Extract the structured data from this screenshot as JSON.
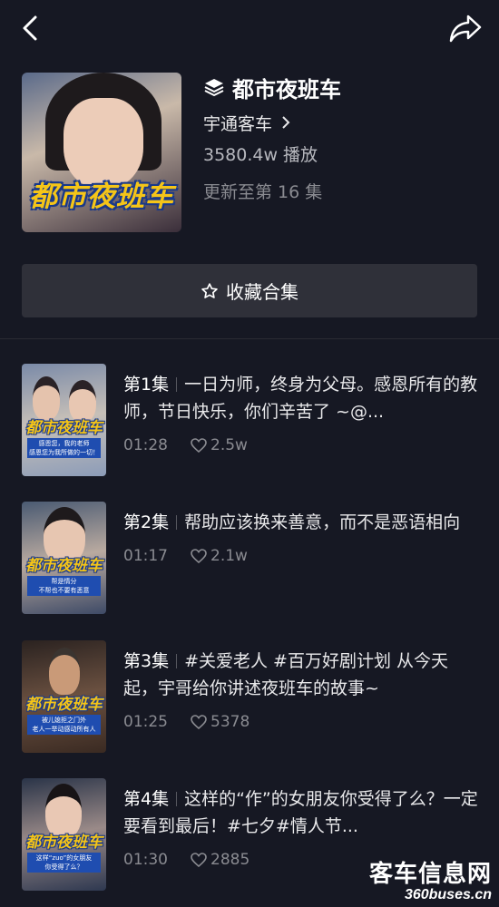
{
  "header": {
    "back_icon": "chevron-left-icon",
    "share_icon": "share-arrow-icon"
  },
  "collection": {
    "cover_title": "都市夜班车",
    "title": "都市夜班车",
    "author": "宇通客车",
    "plays": "3580.4w 播放",
    "updated": "更新至第 16 集",
    "favorite_label": "收藏合集"
  },
  "episodes": [
    {
      "num": "第1集",
      "title": "一日为师，终身为父母。感恩所有的教师，节日快乐，你们辛苦了 ~@...",
      "duration": "01:28",
      "likes": "2.5w",
      "thumb_banner": "都市夜班车",
      "thumb_caption": "感恩您，我的老师\n感恩您为我所做的一切！"
    },
    {
      "num": "第2集",
      "title": "帮助应该换来善意，而不是恶语相向",
      "duration": "01:17",
      "likes": "2.1w",
      "thumb_banner": "都市夜班车",
      "thumb_caption": "帮是情分\n不帮也不要有恶意"
    },
    {
      "num": "第3集",
      "title": "#关爱老人 #百万好剧计划  从今天起，宇哥给你讲述夜班车的故事~",
      "duration": "01:25",
      "likes": "5378",
      "thumb_banner": "都市夜班车",
      "thumb_caption": "被儿媳拒之门外\n老人一举动感动所有人"
    },
    {
      "num": "第4集",
      "title": "这样的“作”的女朋友你受得了么？一定要看到最后！#七夕#情人节...",
      "duration": "01:30",
      "likes": "2885",
      "thumb_banner": "都市夜班车",
      "thumb_caption": "这样“zuo”的女朋友\n你受得了么？"
    }
  ],
  "watermark": {
    "cn": "客车信息网",
    "url": "360buses.cn"
  },
  "colors": {
    "background": "#161823",
    "button_bg": "#2f3039",
    "banner_yellow": "#f5c518",
    "caption_blue": "#1f4db0"
  }
}
